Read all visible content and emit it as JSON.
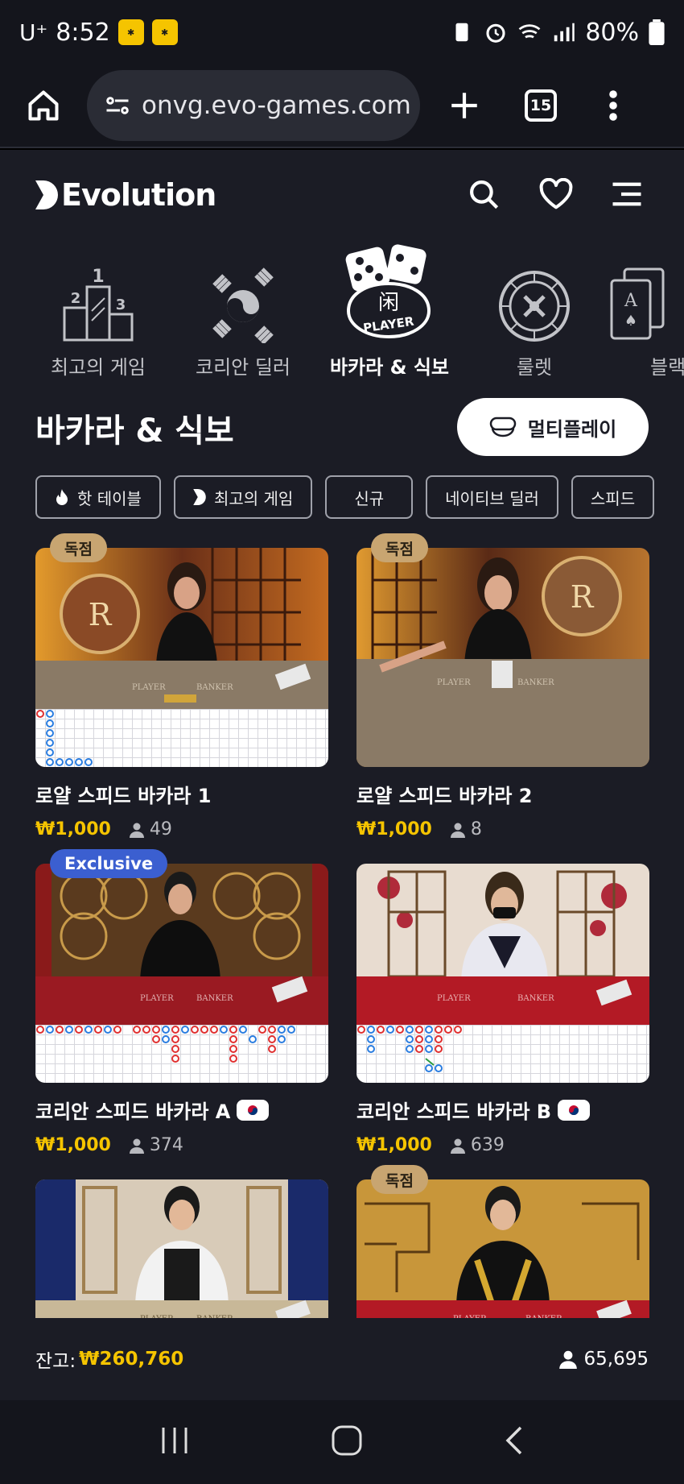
{
  "status": {
    "carrier": "U⁺",
    "time": "8:52",
    "battery": "80%"
  },
  "browser": {
    "url": "onvg.evo-games.com",
    "tab_count": "15"
  },
  "app": {
    "logo": "Evolution",
    "categories": [
      {
        "label": "최고의 게임",
        "icon": "podium-icon"
      },
      {
        "label": "코리안 딜러",
        "icon": "korea-flag-icon"
      },
      {
        "label": "바카라 & 식보",
        "icon": "dice-player-icon",
        "active": true
      },
      {
        "label": "룰렛",
        "icon": "roulette-icon"
      },
      {
        "label": "블랙",
        "icon": "cards-icon"
      }
    ],
    "section_title": "바카라 & 식보",
    "multiplay_label": "멀티플레이",
    "filters": [
      "핫 테이블",
      "최고의 게임",
      "신규",
      "네이티브 딜러",
      "스피드"
    ],
    "cards": [
      {
        "title": "로얄 스피드 바카라 1",
        "price": "₩1,000",
        "players": "49",
        "badge": "독점"
      },
      {
        "title": "로얄 스피드 바카라 2",
        "price": "₩1,000",
        "players": "8",
        "badge": "독점"
      },
      {
        "title": "코리안 스피드 바카라 A",
        "price": "₩1,000",
        "players": "374",
        "badge": "Exclusive"
      },
      {
        "title": "코리안 스피드 바카라 B",
        "price": "₩1,000",
        "players": "639",
        "badge": ""
      },
      {
        "title": "",
        "price": "",
        "players": "",
        "badge": ""
      },
      {
        "title": "",
        "price": "",
        "players": "",
        "badge": "독점"
      }
    ],
    "footer": {
      "balance_label": "잔고:",
      "balance_value": "₩260,760",
      "total_players": "65,695"
    }
  },
  "colors": {
    "accent": "#f5c400",
    "bg": "#1b1c25",
    "badge_gold": "#c8a571",
    "badge_blue": "#3b5fd0"
  }
}
